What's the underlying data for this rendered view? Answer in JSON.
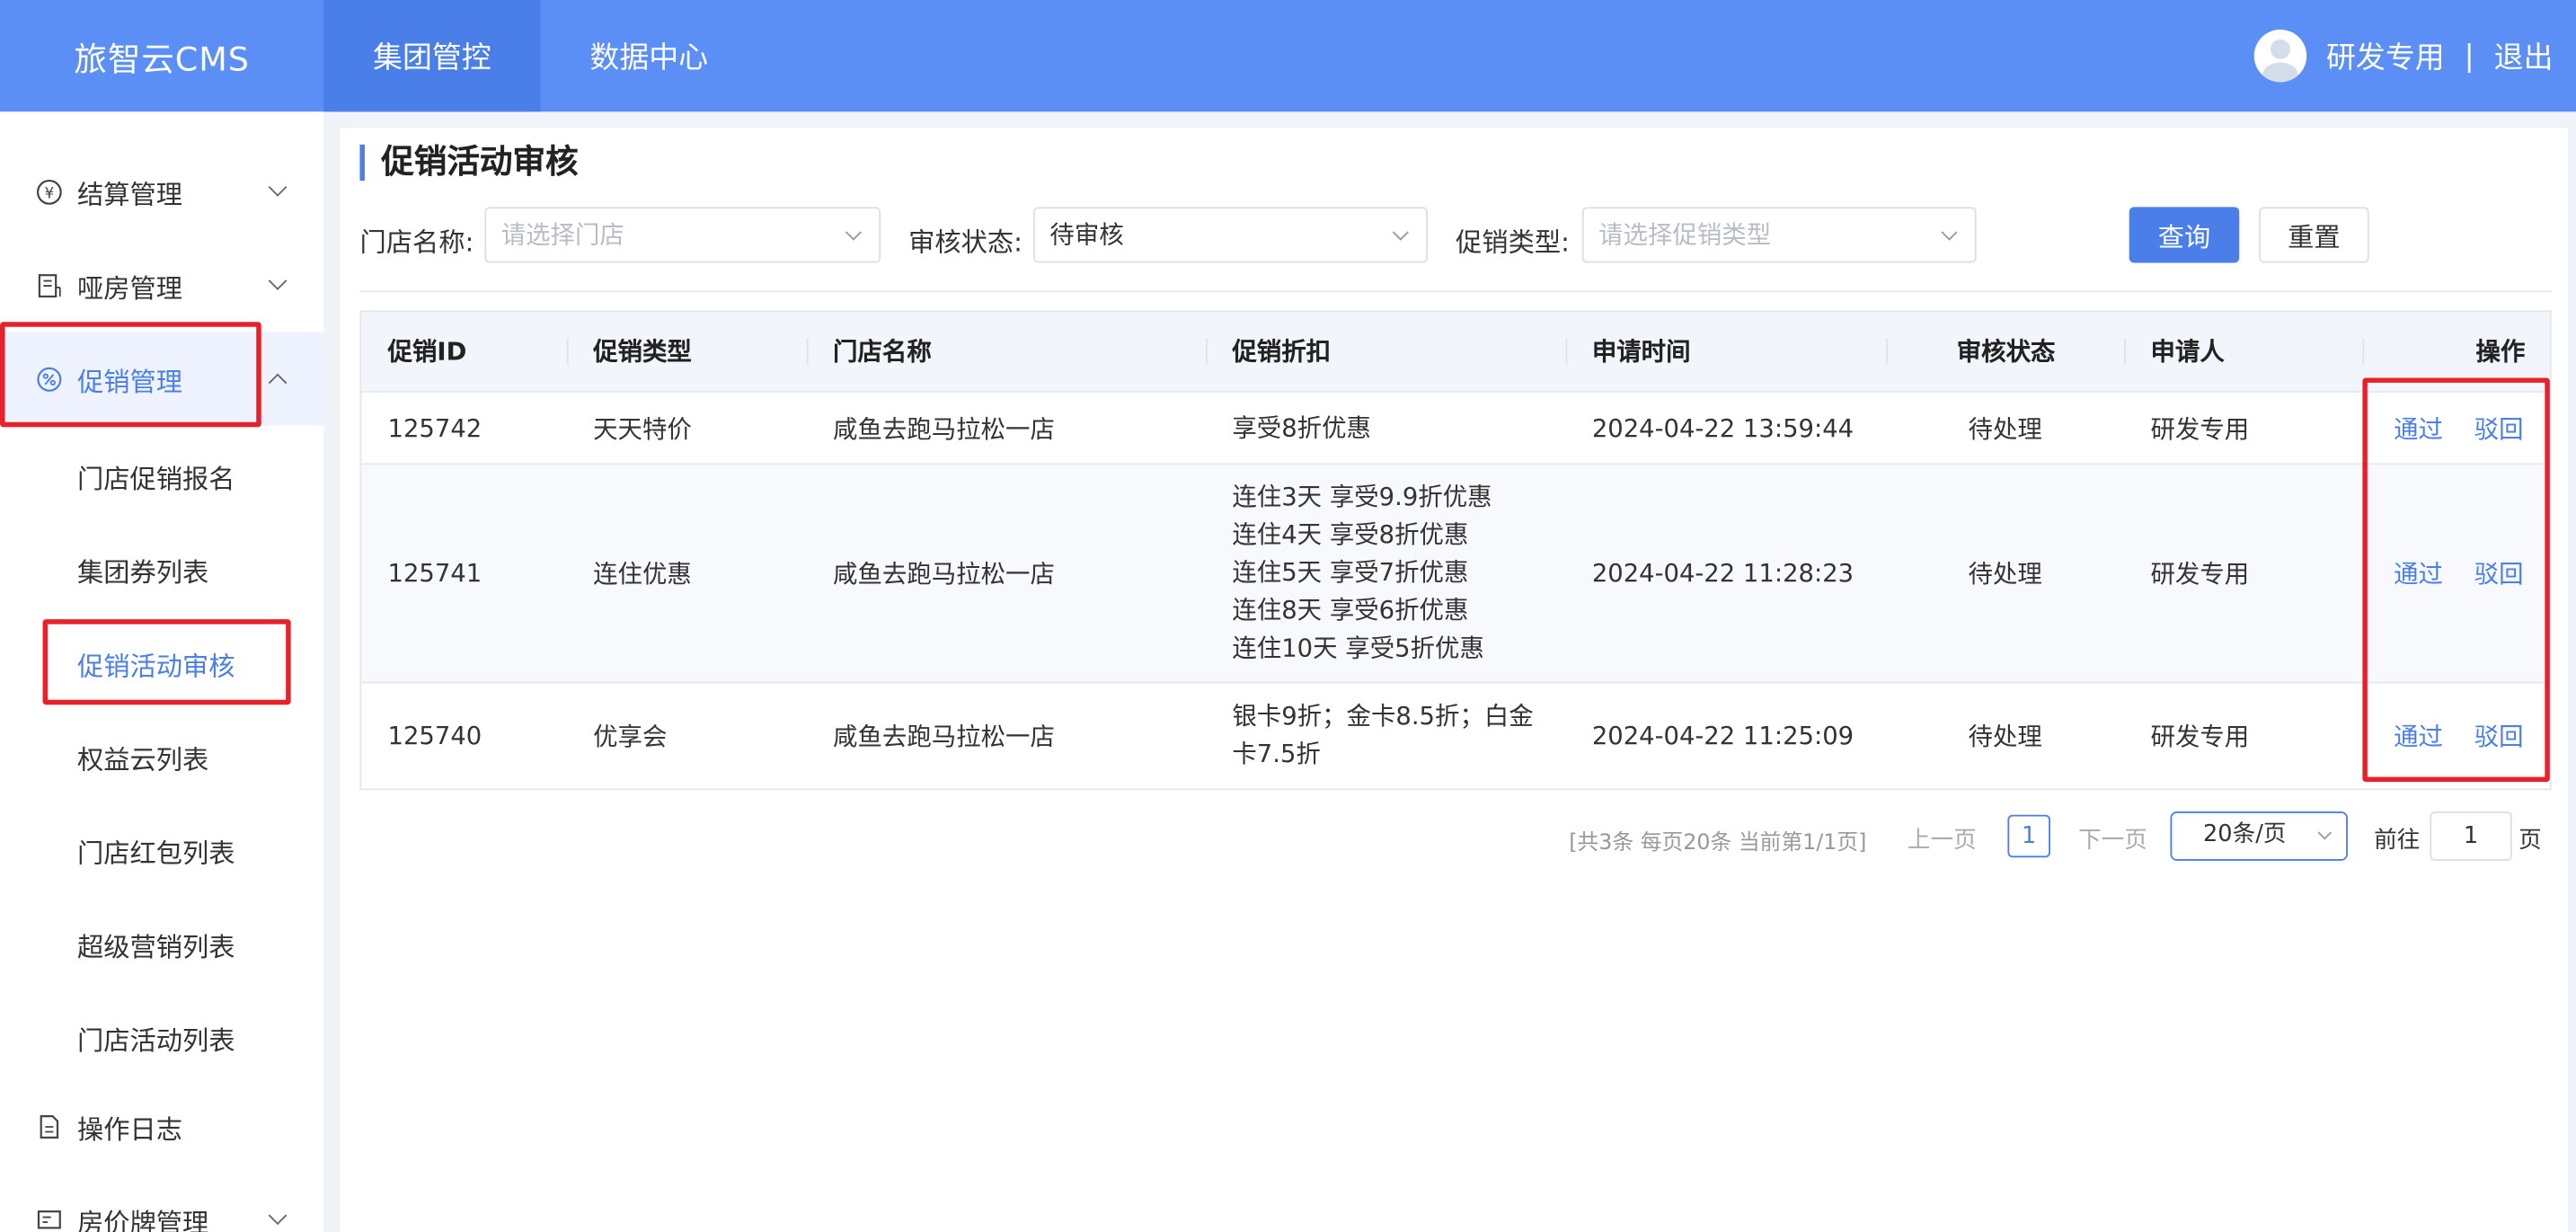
{
  "app": {
    "brand": "旅智云CMS"
  },
  "topnav": [
    {
      "label": "集团管控",
      "active": true
    },
    {
      "label": "数据中心",
      "active": false
    }
  ],
  "user": {
    "name": "研发专用",
    "separator": "|",
    "logout": "退出"
  },
  "sidebar": {
    "groups": [
      {
        "label": "结算管理",
        "icon": "yen-icon"
      },
      {
        "label": "哑房管理",
        "icon": "document-icon"
      },
      {
        "label": "促销管理",
        "icon": "discount-icon",
        "expanded": true
      },
      {
        "label": "操作日志",
        "icon": "log-icon"
      },
      {
        "label": "房价牌管理",
        "icon": "board-icon"
      }
    ],
    "sub_items": [
      "门店促销报名",
      "集团券列表",
      "促销活动审核",
      "权益云列表",
      "门店红包列表",
      "超级营销列表",
      "门店活动列表"
    ],
    "active_sub": "促销活动审核"
  },
  "page": {
    "title": "促销活动审核"
  },
  "filters": {
    "store_label": "门店名称:",
    "store_placeholder": "请选择门店",
    "status_label": "审核状态:",
    "status_value": "待审核",
    "type_label": "促销类型:",
    "type_placeholder": "请选择促销类型",
    "search_button": "查询",
    "reset_button": "重置"
  },
  "table": {
    "headers": [
      "促销ID",
      "促销类型",
      "门店名称",
      "促销折扣",
      "申请时间",
      "审核状态",
      "申请人",
      "操作"
    ],
    "rows": [
      {
        "id": "125742",
        "type": "天天特价",
        "store": "咸鱼去跑马拉松一店",
        "discount": [
          "享受8折优惠"
        ],
        "time": "2024-04-22 13:59:44",
        "status": "待处理",
        "applicant": "研发专用",
        "approve": "通过",
        "reject": "驳回"
      },
      {
        "id": "125741",
        "type": "连住优惠",
        "store": "咸鱼去跑马拉松一店",
        "discount": [
          "连住3天 享受9.9折优惠",
          "连住4天 享受8折优惠",
          "连住5天 享受7折优惠",
          "连住8天 享受6折优惠",
          "连住10天 享受5折优惠"
        ],
        "time": "2024-04-22 11:28:23",
        "status": "待处理",
        "applicant": "研发专用",
        "approve": "通过",
        "reject": "驳回"
      },
      {
        "id": "125740",
        "type": "优享会",
        "store": "咸鱼去跑马拉松一店",
        "discount": [
          "银卡9折；金卡8.5折；白金",
          "卡7.5折"
        ],
        "time": "2024-04-22 11:25:09",
        "status": "待处理",
        "applicant": "研发专用",
        "approve": "通过",
        "reject": "驳回"
      }
    ]
  },
  "pagination": {
    "summary": "[共3条 每页20条 当前第1/1页]",
    "prev": "上一页",
    "current": "1",
    "next": "下一页",
    "page_size": "20条/页",
    "goto_label": "前往",
    "goto_value": "1",
    "page_suffix": "页"
  },
  "colors": {
    "accent": "#4a7ee9",
    "topbar": "#5b8ff5",
    "highlight": "#e8202a"
  }
}
